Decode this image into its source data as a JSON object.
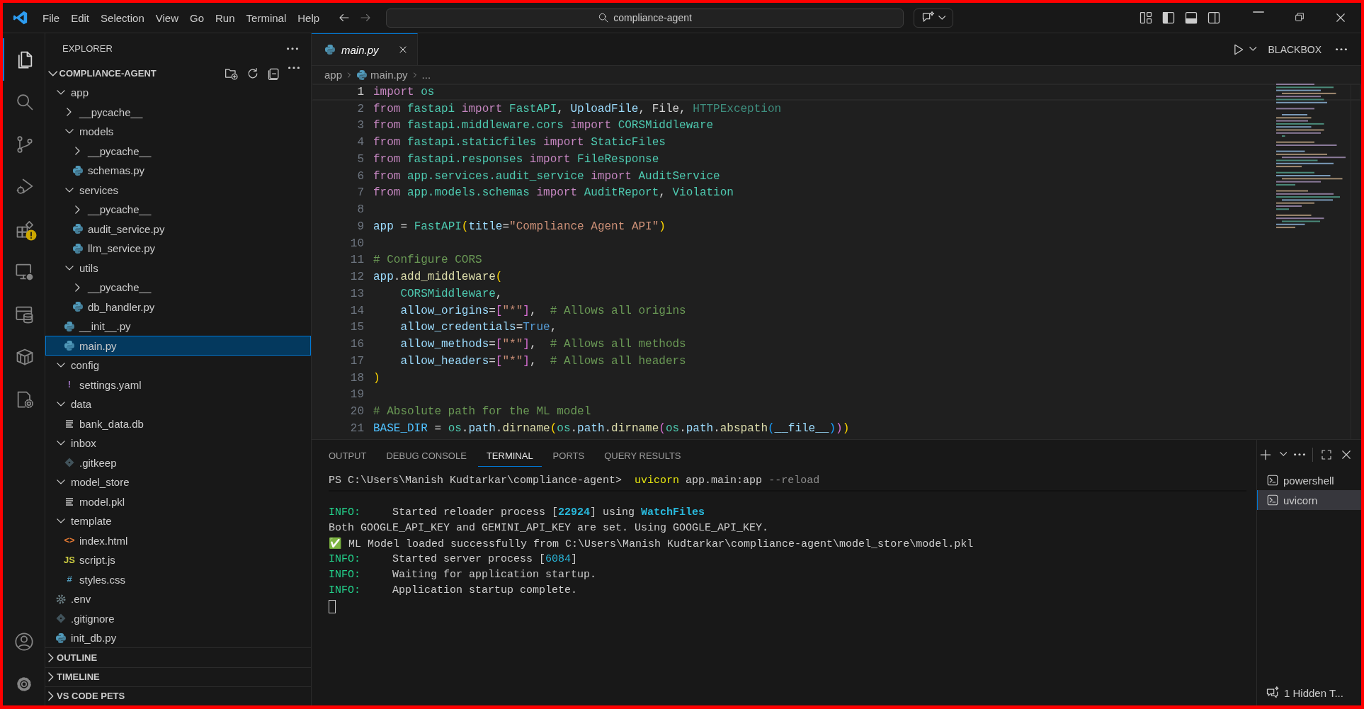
{
  "title_bar": {
    "menu": [
      "File",
      "Edit",
      "Selection",
      "View",
      "Go",
      "Run",
      "Terminal",
      "Help"
    ],
    "search": {
      "value": "compliance-agent"
    }
  },
  "activity_bar": {
    "items": [
      {
        "kind": "explorer",
        "selected": true
      },
      {
        "kind": "search",
        "selected": false
      },
      {
        "kind": "source-control",
        "selected": false
      },
      {
        "kind": "run-debug",
        "selected": false
      },
      {
        "kind": "extensions",
        "selected": false
      },
      {
        "kind": "remote",
        "selected": false
      },
      {
        "kind": "database",
        "selected": false
      },
      {
        "kind": "package",
        "selected": false
      },
      {
        "kind": "doc-settings",
        "selected": false
      }
    ]
  },
  "explorer": {
    "title": "EXPLORER",
    "root": {
      "label": "COMPLIANCE-AGENT",
      "expanded": true
    },
    "tree": [
      {
        "label": "app",
        "kind": "folder",
        "expanded": true,
        "selected": false,
        "children": [
          {
            "label": "__pycache__",
            "kind": "folder",
            "expanded": false,
            "selected": false
          },
          {
            "label": "models",
            "kind": "folder",
            "expanded": true,
            "selected": false,
            "children": [
              {
                "label": "__pycache__",
                "kind": "folder",
                "expanded": false,
                "selected": false
              },
              {
                "label": "schemas.py",
                "kind": "python",
                "selected": false
              }
            ]
          },
          {
            "label": "services",
            "kind": "folder",
            "expanded": true,
            "selected": false,
            "children": [
              {
                "label": "__pycache__",
                "kind": "folder",
                "expanded": false,
                "selected": false
              },
              {
                "label": "audit_service.py",
                "kind": "python",
                "selected": false
              },
              {
                "label": "llm_service.py",
                "kind": "python",
                "selected": false
              }
            ]
          },
          {
            "label": "utils",
            "kind": "folder",
            "expanded": true,
            "selected": false,
            "children": [
              {
                "label": "__pycache__",
                "kind": "folder",
                "expanded": false,
                "selected": false
              },
              {
                "label": "db_handler.py",
                "kind": "python",
                "selected": false
              }
            ]
          },
          {
            "label": "__init__.py",
            "kind": "python",
            "selected": false
          },
          {
            "label": "main.py",
            "kind": "python",
            "selected": true
          }
        ]
      },
      {
        "label": "config",
        "kind": "folder",
        "expanded": true,
        "selected": false,
        "children": [
          {
            "label": "settings.yaml",
            "kind": "yaml",
            "icon": "!",
            "selected": false
          }
        ]
      },
      {
        "label": "data",
        "kind": "folder",
        "expanded": true,
        "selected": false,
        "children": [
          {
            "label": "bank_data.db",
            "kind": "db",
            "selected": false
          }
        ]
      },
      {
        "label": "inbox",
        "kind": "folder",
        "expanded": true,
        "selected": false,
        "children": [
          {
            "label": ".gitkeep",
            "kind": "git",
            "selected": false
          }
        ]
      },
      {
        "label": "model_store",
        "kind": "folder",
        "expanded": true,
        "selected": false,
        "children": [
          {
            "label": "model.pkl",
            "kind": "db",
            "selected": false
          }
        ]
      },
      {
        "label": "template",
        "kind": "folder",
        "expanded": true,
        "selected": false,
        "children": [
          {
            "label": "index.html",
            "kind": "html",
            "icon": "<>",
            "selected": false
          },
          {
            "label": "script.js",
            "kind": "js",
            "icon": "JS",
            "selected": false
          },
          {
            "label": "styles.css",
            "kind": "css",
            "icon": "#",
            "selected": false
          }
        ]
      },
      {
        "label": ".env",
        "kind": "env",
        "selected": false
      },
      {
        "label": ".gitignore",
        "kind": "git",
        "selected": false
      },
      {
        "label": "init_db.py",
        "kind": "python",
        "selected": false
      }
    ],
    "sections": [
      {
        "label": "OUTLINE",
        "expanded": false
      },
      {
        "label": "TIMELINE",
        "expanded": false
      },
      {
        "label": "VS CODE PETS",
        "expanded": false
      }
    ]
  },
  "editor": {
    "tabs": [
      {
        "label": "main.py",
        "selected": true,
        "preview": true
      }
    ],
    "actions_label": "BLACKBOX",
    "breadcrumb": [
      "app",
      "main.py",
      "..."
    ],
    "lines": [
      {
        "number": "1",
        "current": true,
        "tokens": [
          {
            "text": "import",
            "kind": "kw"
          },
          {
            "text": " os",
            "kind": "mod"
          }
        ]
      },
      {
        "number": "2",
        "current": false,
        "tokens": [
          {
            "text": "from",
            "kind": "kw"
          },
          {
            "text": " fastapi ",
            "kind": "mod"
          },
          {
            "text": "import",
            "kind": "kw"
          },
          {
            "text": " FastAPI",
            "kind": "mod"
          },
          {
            "text": ", ",
            "kind": "plain"
          },
          {
            "text": "UploadFile",
            "kind": "var"
          },
          {
            "text": ", File, ",
            "kind": "plain"
          },
          {
            "text": "HTTPException",
            "kind": "unused"
          }
        ]
      },
      {
        "number": "3",
        "current": false,
        "tokens": [
          {
            "text": "from",
            "kind": "kw"
          },
          {
            "text": " fastapi.middleware.cors ",
            "kind": "mod"
          },
          {
            "text": "import",
            "kind": "kw"
          },
          {
            "text": " CORSMiddleware",
            "kind": "mod"
          }
        ]
      },
      {
        "number": "4",
        "current": false,
        "tokens": [
          {
            "text": "from",
            "kind": "kw"
          },
          {
            "text": " fastapi.staticfiles ",
            "kind": "mod"
          },
          {
            "text": "import",
            "kind": "kw"
          },
          {
            "text": " StaticFiles",
            "kind": "mod"
          }
        ]
      },
      {
        "number": "5",
        "current": false,
        "tokens": [
          {
            "text": "from",
            "kind": "kw"
          },
          {
            "text": " fastapi.responses ",
            "kind": "mod"
          },
          {
            "text": "import",
            "kind": "kw"
          },
          {
            "text": " FileResponse",
            "kind": "mod"
          }
        ]
      },
      {
        "number": "6",
        "current": false,
        "tokens": [
          {
            "text": "from",
            "kind": "kw"
          },
          {
            "text": " app.services.audit_service ",
            "kind": "mod"
          },
          {
            "text": "import",
            "kind": "kw"
          },
          {
            "text": " AuditService",
            "kind": "mod"
          }
        ]
      },
      {
        "number": "7",
        "current": false,
        "tokens": [
          {
            "text": "from",
            "kind": "kw"
          },
          {
            "text": " app.models.schemas ",
            "kind": "mod"
          },
          {
            "text": "import",
            "kind": "kw"
          },
          {
            "text": " AuditReport",
            "kind": "mod"
          },
          {
            "text": ", ",
            "kind": "plain"
          },
          {
            "text": "Violation",
            "kind": "mod"
          }
        ]
      },
      {
        "number": "8",
        "current": false
      },
      {
        "number": "9",
        "current": false,
        "tokens": [
          {
            "text": "app",
            "kind": "var"
          },
          {
            "text": " = ",
            "kind": "plain"
          },
          {
            "text": "FastAPI",
            "kind": "mod"
          },
          {
            "text": "(",
            "kind": "b1"
          },
          {
            "text": "title",
            "kind": "var"
          },
          {
            "text": "=",
            "kind": "plain"
          },
          {
            "text": "\"Compliance Agent API\"",
            "kind": "str"
          },
          {
            "text": ")",
            "kind": "b1"
          }
        ]
      },
      {
        "number": "10",
        "current": false
      },
      {
        "number": "11",
        "current": false,
        "tokens": [
          {
            "text": "# Configure CORS",
            "kind": "cmt"
          }
        ]
      },
      {
        "number": "12",
        "current": false,
        "tokens": [
          {
            "text": "app",
            "kind": "var"
          },
          {
            "text": ".",
            "kind": "plain"
          },
          {
            "text": "add_middleware",
            "kind": "fn"
          },
          {
            "text": "(",
            "kind": "b1"
          }
        ]
      },
      {
        "number": "13",
        "current": false,
        "tokens": [
          {
            "text": "    CORSMiddleware",
            "kind": "mod"
          },
          {
            "text": ",",
            "kind": "plain"
          }
        ]
      },
      {
        "number": "14",
        "current": false,
        "tokens": [
          {
            "text": "    allow_origins",
            "kind": "var"
          },
          {
            "text": "=",
            "kind": "plain"
          },
          {
            "text": "[",
            "kind": "b2"
          },
          {
            "text": "\"*\"",
            "kind": "str"
          },
          {
            "text": "]",
            "kind": "b2"
          },
          {
            "text": ",  ",
            "kind": "plain"
          },
          {
            "text": "# Allows all origins",
            "kind": "cmt"
          }
        ]
      },
      {
        "number": "15",
        "current": false,
        "tokens": [
          {
            "text": "    allow_credentials",
            "kind": "var"
          },
          {
            "text": "=",
            "kind": "plain"
          },
          {
            "text": "True",
            "kind": "const"
          },
          {
            "text": ",",
            "kind": "plain"
          }
        ]
      },
      {
        "number": "16",
        "current": false,
        "tokens": [
          {
            "text": "    allow_methods",
            "kind": "var"
          },
          {
            "text": "=",
            "kind": "plain"
          },
          {
            "text": "[",
            "kind": "b2"
          },
          {
            "text": "\"*\"",
            "kind": "str"
          },
          {
            "text": "]",
            "kind": "b2"
          },
          {
            "text": ",  ",
            "kind": "plain"
          },
          {
            "text": "# Allows all methods",
            "kind": "cmt"
          }
        ]
      },
      {
        "number": "17",
        "current": false,
        "tokens": [
          {
            "text": "    allow_headers",
            "kind": "var"
          },
          {
            "text": "=",
            "kind": "plain"
          },
          {
            "text": "[",
            "kind": "b2"
          },
          {
            "text": "\"*\"",
            "kind": "str"
          },
          {
            "text": "]",
            "kind": "b2"
          },
          {
            "text": ",  ",
            "kind": "plain"
          },
          {
            "text": "# Allows all headers",
            "kind": "cmt"
          }
        ]
      },
      {
        "number": "18",
        "current": false,
        "tokens": [
          {
            "text": ")",
            "kind": "b1"
          }
        ]
      },
      {
        "number": "19",
        "current": false
      },
      {
        "number": "20",
        "current": false,
        "tokens": [
          {
            "text": "# Absolute path for the ML model",
            "kind": "cmt"
          }
        ]
      },
      {
        "number": "21",
        "current": false,
        "tokens": [
          {
            "text": "BASE_DIR",
            "kind": "const2"
          },
          {
            "text": " = ",
            "kind": "plain"
          },
          {
            "text": "os",
            "kind": "mod"
          },
          {
            "text": ".",
            "kind": "plain"
          },
          {
            "text": "path",
            "kind": "var"
          },
          {
            "text": ".",
            "kind": "plain"
          },
          {
            "text": "dirname",
            "kind": "fn"
          },
          {
            "text": "(",
            "kind": "b1"
          },
          {
            "text": "os",
            "kind": "mod"
          },
          {
            "text": ".",
            "kind": "plain"
          },
          {
            "text": "path",
            "kind": "var"
          },
          {
            "text": ".",
            "kind": "plain"
          },
          {
            "text": "dirname",
            "kind": "fn"
          },
          {
            "text": "(",
            "kind": "b2"
          },
          {
            "text": "os",
            "kind": "mod"
          },
          {
            "text": ".",
            "kind": "plain"
          },
          {
            "text": "path",
            "kind": "var"
          },
          {
            "text": ".",
            "kind": "plain"
          },
          {
            "text": "abspath",
            "kind": "fn"
          },
          {
            "text": "(",
            "kind": "b3"
          },
          {
            "text": "__file__",
            "kind": "var"
          },
          {
            "text": ")",
            "kind": "b3"
          },
          {
            "text": ")",
            "kind": "b2"
          },
          {
            "text": ")",
            "kind": "b1"
          }
        ]
      }
    ]
  },
  "panel": {
    "tabs": [
      {
        "label": "OUTPUT",
        "selected": false
      },
      {
        "label": "DEBUG CONSOLE",
        "selected": false
      },
      {
        "label": "TERMINAL",
        "selected": true
      },
      {
        "label": "PORTS",
        "selected": false
      },
      {
        "label": "QUERY RESULTS",
        "selected": false
      }
    ],
    "terminal": {
      "command": [
        {
          "text": "PS C:\\Users\\Manish Kudtarkar\\compliance-agent>  ",
          "kind": "plain"
        },
        {
          "text": "uvicorn",
          "kind": "cmd"
        },
        {
          "text": " app.main:app ",
          "kind": "plain"
        },
        {
          "text": "--reload",
          "kind": "flag"
        }
      ],
      "lines": [
        [
          {
            "text": "INFO:",
            "kind": "info"
          },
          {
            "text": "     Started reloader process [",
            "kind": "plain"
          },
          {
            "text": "22924",
            "kind": "num_bold"
          },
          {
            "text": "] using ",
            "kind": "plain"
          },
          {
            "text": "WatchFiles",
            "kind": "num_bold"
          }
        ],
        [
          {
            "text": "Both GOOGLE_API_KEY and GEMINI_API_KEY are set. Using GOOGLE_API_KEY.",
            "kind": "plain"
          }
        ],
        [
          {
            "text": "✅",
            "kind": "emoji"
          },
          {
            "text": " ML Model loaded successfully from C:\\Users\\Manish Kudtarkar\\compliance-agent\\model_store\\model.pkl",
            "kind": "plain"
          }
        ],
        [
          {
            "text": "INFO:",
            "kind": "info"
          },
          {
            "text": "     Started server process [",
            "kind": "plain"
          },
          {
            "text": "6084",
            "kind": "num"
          },
          {
            "text": "]",
            "kind": "plain"
          }
        ],
        [
          {
            "text": "INFO:",
            "kind": "info"
          },
          {
            "text": "     Waiting for application startup.",
            "kind": "plain"
          }
        ],
        [
          {
            "text": "INFO:",
            "kind": "info"
          },
          {
            "text": "     Application startup complete.",
            "kind": "plain"
          }
        ]
      ]
    },
    "sessions": [
      {
        "label": "powershell",
        "selected": false
      },
      {
        "label": "uvicorn",
        "selected": true
      }
    ],
    "hidden_label": "1 Hidden T..."
  }
}
